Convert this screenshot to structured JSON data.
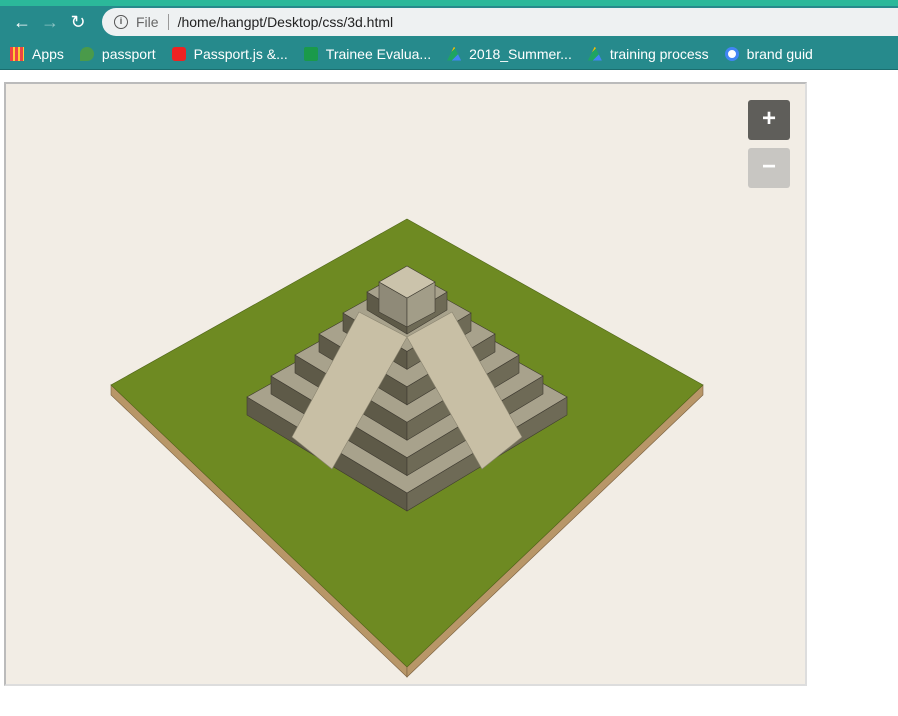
{
  "browser": {
    "url_scheme_label": "File",
    "url": "/home/hangpt/Desktop/css/3d.html",
    "bookmarks": [
      {
        "label": "Apps",
        "icon": "apps-grid-icon"
      },
      {
        "label": "passport",
        "icon": "leaf-icon"
      },
      {
        "label": "Passport.js &...",
        "icon": "youtube-icon"
      },
      {
        "label": "Trainee Evalua...",
        "icon": "sheets-icon"
      },
      {
        "label": "2018_Summer...",
        "icon": "drive-icon"
      },
      {
        "label": "training process",
        "icon": "drive-icon"
      },
      {
        "label": "brand guid",
        "icon": "google-icon"
      }
    ]
  },
  "scene": {
    "zoom_in_label": "+",
    "zoom_out_label": "−",
    "colors": {
      "ground": "#6e8a22",
      "soil": "#b89668",
      "stone_top": "#a8a28c",
      "stone_side": "#5e5a48",
      "stair": "#c8bfa5",
      "zoom_in": "#5f5e5a",
      "zoom_out": "#c8c6c2"
    }
  }
}
